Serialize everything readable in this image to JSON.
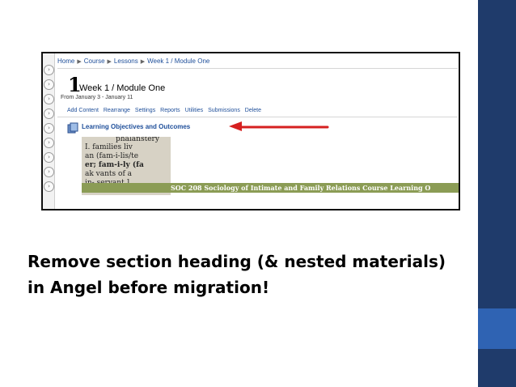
{
  "slide": {
    "caption_line1": "Remove section heading (& nested materials)",
    "caption_line2": "in Angel before migration!",
    "band_color": "#1f3b6b",
    "band_accent_color": "#2f63b3"
  },
  "lms": {
    "breadcrumb": [
      "Home",
      "Course",
      "Lessons",
      "Week 1 / Module One"
    ],
    "week_number": "1",
    "page_title": "Week 1 / Module One",
    "date_range": "From January 3 - January 11",
    "actions": [
      "Add Content",
      "Rearrange",
      "Settings",
      "Reports",
      "Utilities",
      "Submissions",
      "Delete"
    ],
    "section_title": "Learning Objectives and Outcomes",
    "image": {
      "dictionary_lines": [
        "phalanstery",
        "I.   families liv",
        "an   (fam-i-lis/te",
        "er;  fam-i-ly (fa",
        "ak   vants of a",
        "in-  servant.]"
      ],
      "banner_text": "SOC 208 Sociology of Intimate and Family Relations Course Learning O"
    },
    "accent_color": "#1f4f9a",
    "arrow_color": "#d62020",
    "icons": [
      "rail-button-icon",
      "section-item-icon",
      "red-arrow-icon"
    ]
  }
}
